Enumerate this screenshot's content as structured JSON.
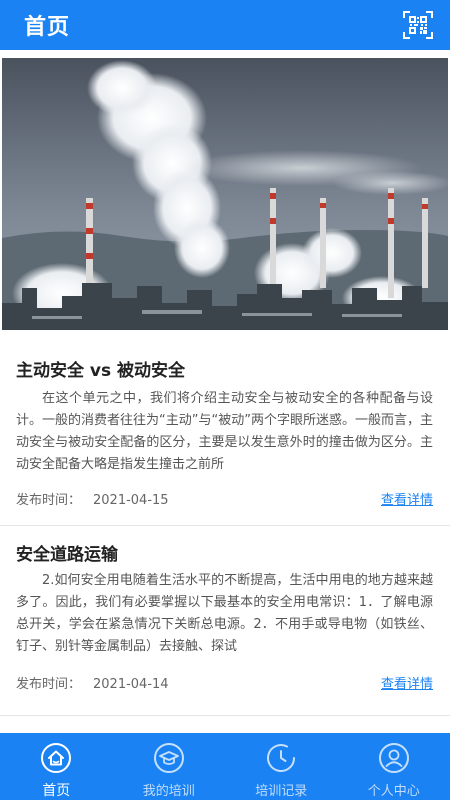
{
  "header": {
    "title": "首页"
  },
  "articles": [
    {
      "title": "主动安全 vs 被动安全",
      "body": "在这个单元之中，我们将介绍主动安全与被动安全的各种配备与设计。一般的消费者往往为“主动”与“被动”两个字眼所迷惑。一般而言，主动安全与被动安全配备的区分，主要是以发生意外时的撞击做为区分。主动安全配备大略是指发生撞击之前所",
      "date_label": "发布时间：",
      "date": "2021-04-15",
      "link_label": "查看详情"
    },
    {
      "title": "安全道路运输",
      "body": "2.如何安全用电随着生活水平的不断提高，生活中用电的地方越来越多了。因此，我们有必要掌握以下最基本的安全用电常识：1．了解电源总开关，学会在紧急情况下关断总电源。2．不用手或导电物（如铁丝、钉子、别针等金属制品）去接触、探试",
      "date_label": "发布时间：",
      "date": "2021-04-14",
      "link_label": "查看详情"
    }
  ],
  "tabbar": {
    "items": [
      {
        "label": "首页",
        "icon": "home-icon",
        "active": true
      },
      {
        "label": "我的培训",
        "icon": "graduation-cap-icon",
        "active": false
      },
      {
        "label": "培训记录",
        "icon": "clock-icon",
        "active": false
      },
      {
        "label": "个人中心",
        "icon": "user-icon",
        "active": false
      }
    ]
  },
  "colors": {
    "primary": "#1a82f3",
    "link": "#1a82f3",
    "title_text": "#222222",
    "body_text": "#555555"
  }
}
